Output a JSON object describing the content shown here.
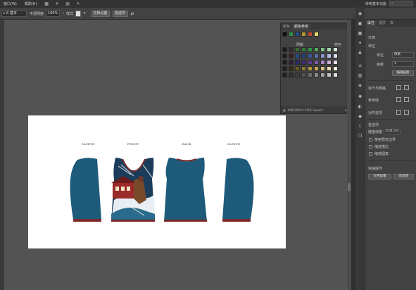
{
  "menubar": {
    "items": [
      "窗口(W)",
      "帮助(H)"
    ],
    "right_text": "传统基本功能",
    "icons": [
      "grid-icon",
      "launch-icon",
      "layout-icon",
      "brush-icon"
    ]
  },
  "control_bar": {
    "select_mode": "ß 基本",
    "opacity_label": "不透明度",
    "opacity_value": "100%",
    "style_label": "样式",
    "doc_setup_button": "文档设置",
    "preferences_button": "首选项"
  },
  "swatches": {
    "tabs": [
      "颜色",
      "颜色参考"
    ],
    "col_headers": [
      "阴暗",
      "亮色"
    ],
    "footer_text": "PANTONE® 0001 Swatch",
    "colors": {
      "rows": [
        [
          "#1a1a1a",
          "#2b2b2b",
          "#3d6b35",
          "#2f7e3a",
          "#2f9448",
          "#52aa5a",
          "#7cc18a",
          "#a8d6b0",
          "#d6ece0"
        ],
        [
          "#1b1b1b",
          "#3a1f1f",
          "#234d8a",
          "#29407a",
          "#3d5598",
          "#5b73ad",
          "#8598c6",
          "#b2bedf",
          "#dae0f0"
        ],
        [
          "#1c1c1c",
          "#2b1f35",
          "#2b2b6a",
          "#3d2f7a",
          "#5a3b8f",
          "#7e5aa7",
          "#a784c2",
          "#c9b0d9",
          "#e8dcf0"
        ],
        [
          "#1d1d1d",
          "#3a2a10",
          "#6b5a1f",
          "#8a7a2e",
          "#b29a3b",
          "#caa65a",
          "#ddc184",
          "#ead9b2",
          "#f6eedb"
        ],
        [
          "#1e1e1e",
          "#2e2e2e",
          "#3d3d3d",
          "#555555",
          "#6e6e6e",
          "#8a8a8a",
          "#a6a6a6",
          "#c4c4c4",
          "#e2e2e2"
        ]
      ]
    }
  },
  "artboard": {
    "labels": [
      "SLEEVE",
      "FRONT",
      "BACK",
      "SLEEVE"
    ],
    "colors": {
      "garment": "#1e5b7a",
      "trim": "#8a2a2a"
    }
  },
  "properties": {
    "tabs": [
      "属性",
      "图层",
      "库"
    ],
    "section_doc": "文档",
    "unit_label": "单位",
    "unit_value": "像素",
    "artboard_label": "画板",
    "artboard_value": "1",
    "edit_artboards_button": "编辑画板",
    "ruler_grid_label": "标尺与网格",
    "guides_label": "参考线",
    "snap_label": "对齐选项",
    "preferences_section": "首选项",
    "keyboard_inc_label": "键盘增量",
    "keyboard_inc_value": "0.01 cm",
    "checkbox_1": "使用预览边界",
    "checkbox_2": "缩放描边",
    "checkbox_3": "缩放圆角",
    "quick_actions_label": "快速操作",
    "doc_setup_button": "文档设置",
    "prefs_button": "首选项"
  }
}
